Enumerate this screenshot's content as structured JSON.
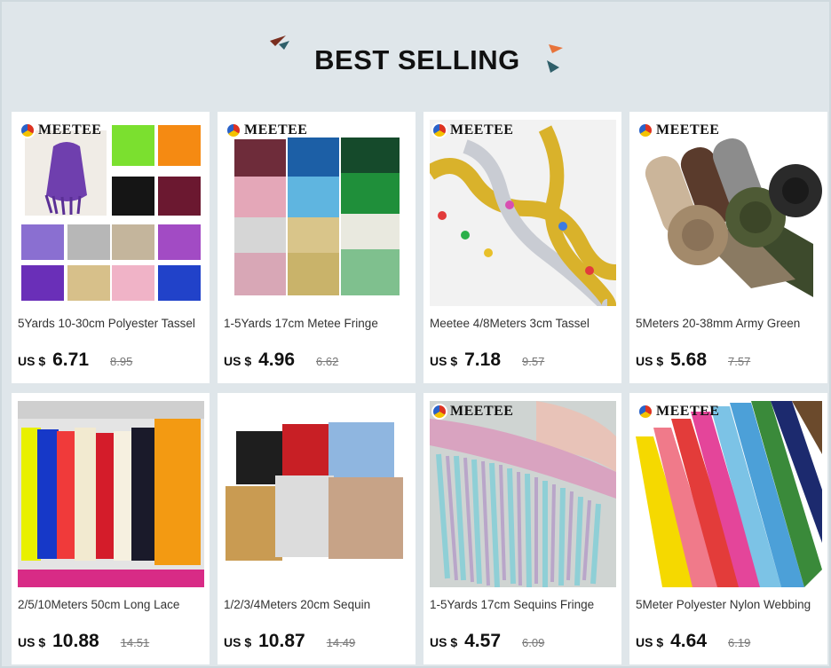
{
  "header": {
    "title": "BEST SELLING"
  },
  "brand_name": "MEETEE",
  "products": [
    {
      "name": "5Yards 10-30cm Polyester Tassel",
      "currency": "US $",
      "price": "6.71",
      "original_price": "8.95",
      "branded": true,
      "image": "tassel-color-grid"
    },
    {
      "name": "1-5Yards 17cm Metee Fringe",
      "currency": "US $",
      "price": "4.96",
      "original_price": "6.62",
      "branded": true,
      "image": "sequin-fringe-grid"
    },
    {
      "name": "Meetee 4/8Meters 3cm Tassel",
      "currency": "US $",
      "price": "7.18",
      "original_price": "9.57",
      "branded": true,
      "image": "gold-silver-trim"
    },
    {
      "name": "5Meters 20-38mm Army Green",
      "currency": "US $",
      "price": "5.68",
      "original_price": "7.57",
      "branded": true,
      "image": "webbing-rolls"
    },
    {
      "name": "2/5/10Meters 50cm Long Lace",
      "currency": "US $",
      "price": "10.88",
      "original_price": "14.51",
      "branded": false,
      "image": "long-fringe-rack"
    },
    {
      "name": "1/2/3/4Meters 20cm Sequin",
      "currency": "US $",
      "price": "10.87",
      "original_price": "14.49",
      "branded": false,
      "image": "sequin-fringe-stack"
    },
    {
      "name": "1-5Yards 17cm Sequins Fringe",
      "currency": "US $",
      "price": "4.57",
      "original_price": "6.09",
      "branded": true,
      "image": "sequin-fringe-closeup"
    },
    {
      "name": "5Meter Polyester Nylon Webbing",
      "currency": "US $",
      "price": "4.64",
      "original_price": "6.19",
      "branded": true,
      "image": "color-webbing-strips"
    }
  ],
  "colors": {
    "background": "#dfe6ea",
    "card": "#ffffff",
    "accent_orange": "#e8743b",
    "accent_teal": "#2f6f7a"
  }
}
